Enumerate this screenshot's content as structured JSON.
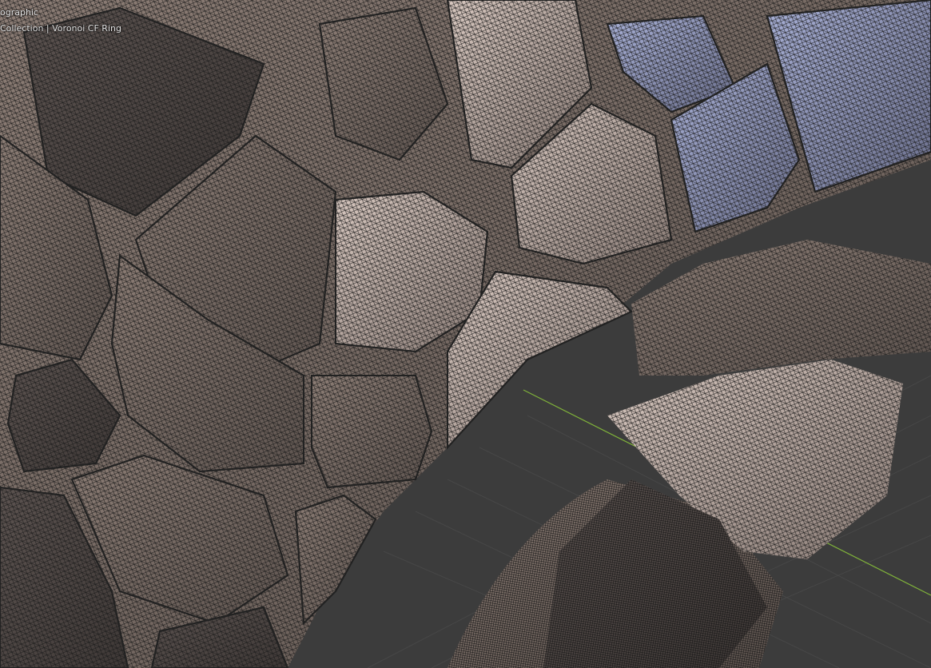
{
  "viewport": {
    "view_label": "ographic",
    "collection_line": {
      "collection": "Collection",
      "separator": "|",
      "object": "Voronoi CF Ring"
    }
  },
  "mesh": {
    "shading": "wireframe-overlay",
    "base_color": "#7d7068",
    "highlight_color": "#c8b8b0",
    "cool_color": "#9aa3c6",
    "edge_color": "#1a1a1a"
  },
  "axes": {
    "x_color": "#b54a4a",
    "y_color": "#7fb13a"
  },
  "grid": {
    "floor_color": "#3c3c3c",
    "line_color": "#464646"
  }
}
